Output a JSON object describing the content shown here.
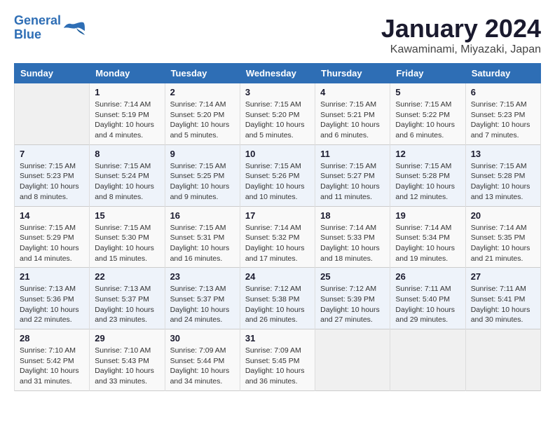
{
  "header": {
    "logo_line1": "General",
    "logo_line2": "Blue",
    "title": "January 2024",
    "subtitle": "Kawaminami, Miyazaki, Japan"
  },
  "weekdays": [
    "Sunday",
    "Monday",
    "Tuesday",
    "Wednesday",
    "Thursday",
    "Friday",
    "Saturday"
  ],
  "weeks": [
    [
      {
        "day": "",
        "info": ""
      },
      {
        "day": "1",
        "info": "Sunrise: 7:14 AM\nSunset: 5:19 PM\nDaylight: 10 hours\nand 4 minutes."
      },
      {
        "day": "2",
        "info": "Sunrise: 7:14 AM\nSunset: 5:20 PM\nDaylight: 10 hours\nand 5 minutes."
      },
      {
        "day": "3",
        "info": "Sunrise: 7:15 AM\nSunset: 5:20 PM\nDaylight: 10 hours\nand 5 minutes."
      },
      {
        "day": "4",
        "info": "Sunrise: 7:15 AM\nSunset: 5:21 PM\nDaylight: 10 hours\nand 6 minutes."
      },
      {
        "day": "5",
        "info": "Sunrise: 7:15 AM\nSunset: 5:22 PM\nDaylight: 10 hours\nand 6 minutes."
      },
      {
        "day": "6",
        "info": "Sunrise: 7:15 AM\nSunset: 5:23 PM\nDaylight: 10 hours\nand 7 minutes."
      }
    ],
    [
      {
        "day": "7",
        "info": "Sunrise: 7:15 AM\nSunset: 5:23 PM\nDaylight: 10 hours\nand 8 minutes."
      },
      {
        "day": "8",
        "info": "Sunrise: 7:15 AM\nSunset: 5:24 PM\nDaylight: 10 hours\nand 8 minutes."
      },
      {
        "day": "9",
        "info": "Sunrise: 7:15 AM\nSunset: 5:25 PM\nDaylight: 10 hours\nand 9 minutes."
      },
      {
        "day": "10",
        "info": "Sunrise: 7:15 AM\nSunset: 5:26 PM\nDaylight: 10 hours\nand 10 minutes."
      },
      {
        "day": "11",
        "info": "Sunrise: 7:15 AM\nSunset: 5:27 PM\nDaylight: 10 hours\nand 11 minutes."
      },
      {
        "day": "12",
        "info": "Sunrise: 7:15 AM\nSunset: 5:28 PM\nDaylight: 10 hours\nand 12 minutes."
      },
      {
        "day": "13",
        "info": "Sunrise: 7:15 AM\nSunset: 5:28 PM\nDaylight: 10 hours\nand 13 minutes."
      }
    ],
    [
      {
        "day": "14",
        "info": "Sunrise: 7:15 AM\nSunset: 5:29 PM\nDaylight: 10 hours\nand 14 minutes."
      },
      {
        "day": "15",
        "info": "Sunrise: 7:15 AM\nSunset: 5:30 PM\nDaylight: 10 hours\nand 15 minutes."
      },
      {
        "day": "16",
        "info": "Sunrise: 7:15 AM\nSunset: 5:31 PM\nDaylight: 10 hours\nand 16 minutes."
      },
      {
        "day": "17",
        "info": "Sunrise: 7:14 AM\nSunset: 5:32 PM\nDaylight: 10 hours\nand 17 minutes."
      },
      {
        "day": "18",
        "info": "Sunrise: 7:14 AM\nSunset: 5:33 PM\nDaylight: 10 hours\nand 18 minutes."
      },
      {
        "day": "19",
        "info": "Sunrise: 7:14 AM\nSunset: 5:34 PM\nDaylight: 10 hours\nand 19 minutes."
      },
      {
        "day": "20",
        "info": "Sunrise: 7:14 AM\nSunset: 5:35 PM\nDaylight: 10 hours\nand 21 minutes."
      }
    ],
    [
      {
        "day": "21",
        "info": "Sunrise: 7:13 AM\nSunset: 5:36 PM\nDaylight: 10 hours\nand 22 minutes."
      },
      {
        "day": "22",
        "info": "Sunrise: 7:13 AM\nSunset: 5:37 PM\nDaylight: 10 hours\nand 23 minutes."
      },
      {
        "day": "23",
        "info": "Sunrise: 7:13 AM\nSunset: 5:37 PM\nDaylight: 10 hours\nand 24 minutes."
      },
      {
        "day": "24",
        "info": "Sunrise: 7:12 AM\nSunset: 5:38 PM\nDaylight: 10 hours\nand 26 minutes."
      },
      {
        "day": "25",
        "info": "Sunrise: 7:12 AM\nSunset: 5:39 PM\nDaylight: 10 hours\nand 27 minutes."
      },
      {
        "day": "26",
        "info": "Sunrise: 7:11 AM\nSunset: 5:40 PM\nDaylight: 10 hours\nand 29 minutes."
      },
      {
        "day": "27",
        "info": "Sunrise: 7:11 AM\nSunset: 5:41 PM\nDaylight: 10 hours\nand 30 minutes."
      }
    ],
    [
      {
        "day": "28",
        "info": "Sunrise: 7:10 AM\nSunset: 5:42 PM\nDaylight: 10 hours\nand 31 minutes."
      },
      {
        "day": "29",
        "info": "Sunrise: 7:10 AM\nSunset: 5:43 PM\nDaylight: 10 hours\nand 33 minutes."
      },
      {
        "day": "30",
        "info": "Sunrise: 7:09 AM\nSunset: 5:44 PM\nDaylight: 10 hours\nand 34 minutes."
      },
      {
        "day": "31",
        "info": "Sunrise: 7:09 AM\nSunset: 5:45 PM\nDaylight: 10 hours\nand 36 minutes."
      },
      {
        "day": "",
        "info": ""
      },
      {
        "day": "",
        "info": ""
      },
      {
        "day": "",
        "info": ""
      }
    ]
  ]
}
